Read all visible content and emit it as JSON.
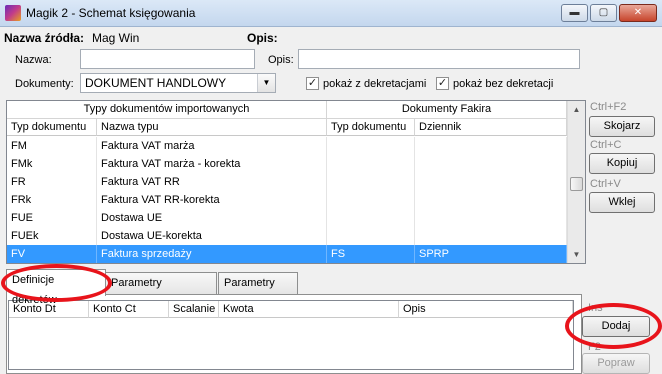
{
  "window": {
    "title": "Magik 2 - Schemat księgowania",
    "min_glyph": "▬",
    "max_glyph": "▢",
    "close_glyph": "✕"
  },
  "header": {
    "source_label": "Nazwa źródła:",
    "source_value": "Mag Win",
    "desc_label": "Opis:"
  },
  "form": {
    "name_label": "Nazwa:",
    "name_value": "",
    "opis_label": "Opis:",
    "opis_value": "",
    "docs_label": "Dokumenty:",
    "docs_value": "DOKUMENT HANDLOWY",
    "chk_with_label": "pokaż z dekretacjami",
    "chk_with_checked": true,
    "chk_without_label": "pokaż bez dekretacji",
    "chk_without_checked": true,
    "check_glyph": "✓",
    "arrow_glyph": "▼"
  },
  "grid": {
    "group_imported": "Typy dokumentów importowanych",
    "group_fakir": "Dokumenty Fakira",
    "columns": [
      "Typ dokumentu",
      "Nazwa typu",
      "Typ dokumentu",
      "Dziennik"
    ],
    "rows": [
      [
        "FM",
        "Faktura VAT marża",
        "",
        ""
      ],
      [
        "FMk",
        "Faktura VAT marża - korekta",
        "",
        ""
      ],
      [
        "FR",
        "Faktura VAT RR",
        "",
        ""
      ],
      [
        "FRk",
        "Faktura VAT RR-korekta",
        "",
        ""
      ],
      [
        "FUE",
        "Dostawa UE",
        "",
        ""
      ],
      [
        "FUEk",
        "Dostawa UE-korekta",
        "",
        ""
      ],
      [
        "FV",
        "Faktura sprzedaży",
        "FS",
        "SPRP"
      ]
    ],
    "selected_row": 6,
    "scroll_up_glyph": "▲",
    "scroll_down_glyph": "▼"
  },
  "side_actions": [
    {
      "shortcut": "Ctrl+F2",
      "label": "Skojarz"
    },
    {
      "shortcut": "Ctrl+C",
      "label": "Kopiuj"
    },
    {
      "shortcut": "Ctrl+V",
      "label": "Wklej"
    }
  ],
  "tabs": [
    "Definicje dekretów",
    "Parametry dokumentu",
    "Parametry VAT"
  ],
  "active_tab": 0,
  "lower_grid": {
    "columns": [
      "Konto Dt",
      "Konto Ct",
      "Scalanie",
      "Kwota",
      "Opis"
    ]
  },
  "lower_actions": [
    {
      "shortcut": "Ins",
      "label": "Dodaj",
      "enabled": true
    },
    {
      "shortcut": "F2",
      "label": "Popraw",
      "enabled": false
    }
  ],
  "highlight_color": "#e8141b",
  "selection_color": "#3399ff"
}
